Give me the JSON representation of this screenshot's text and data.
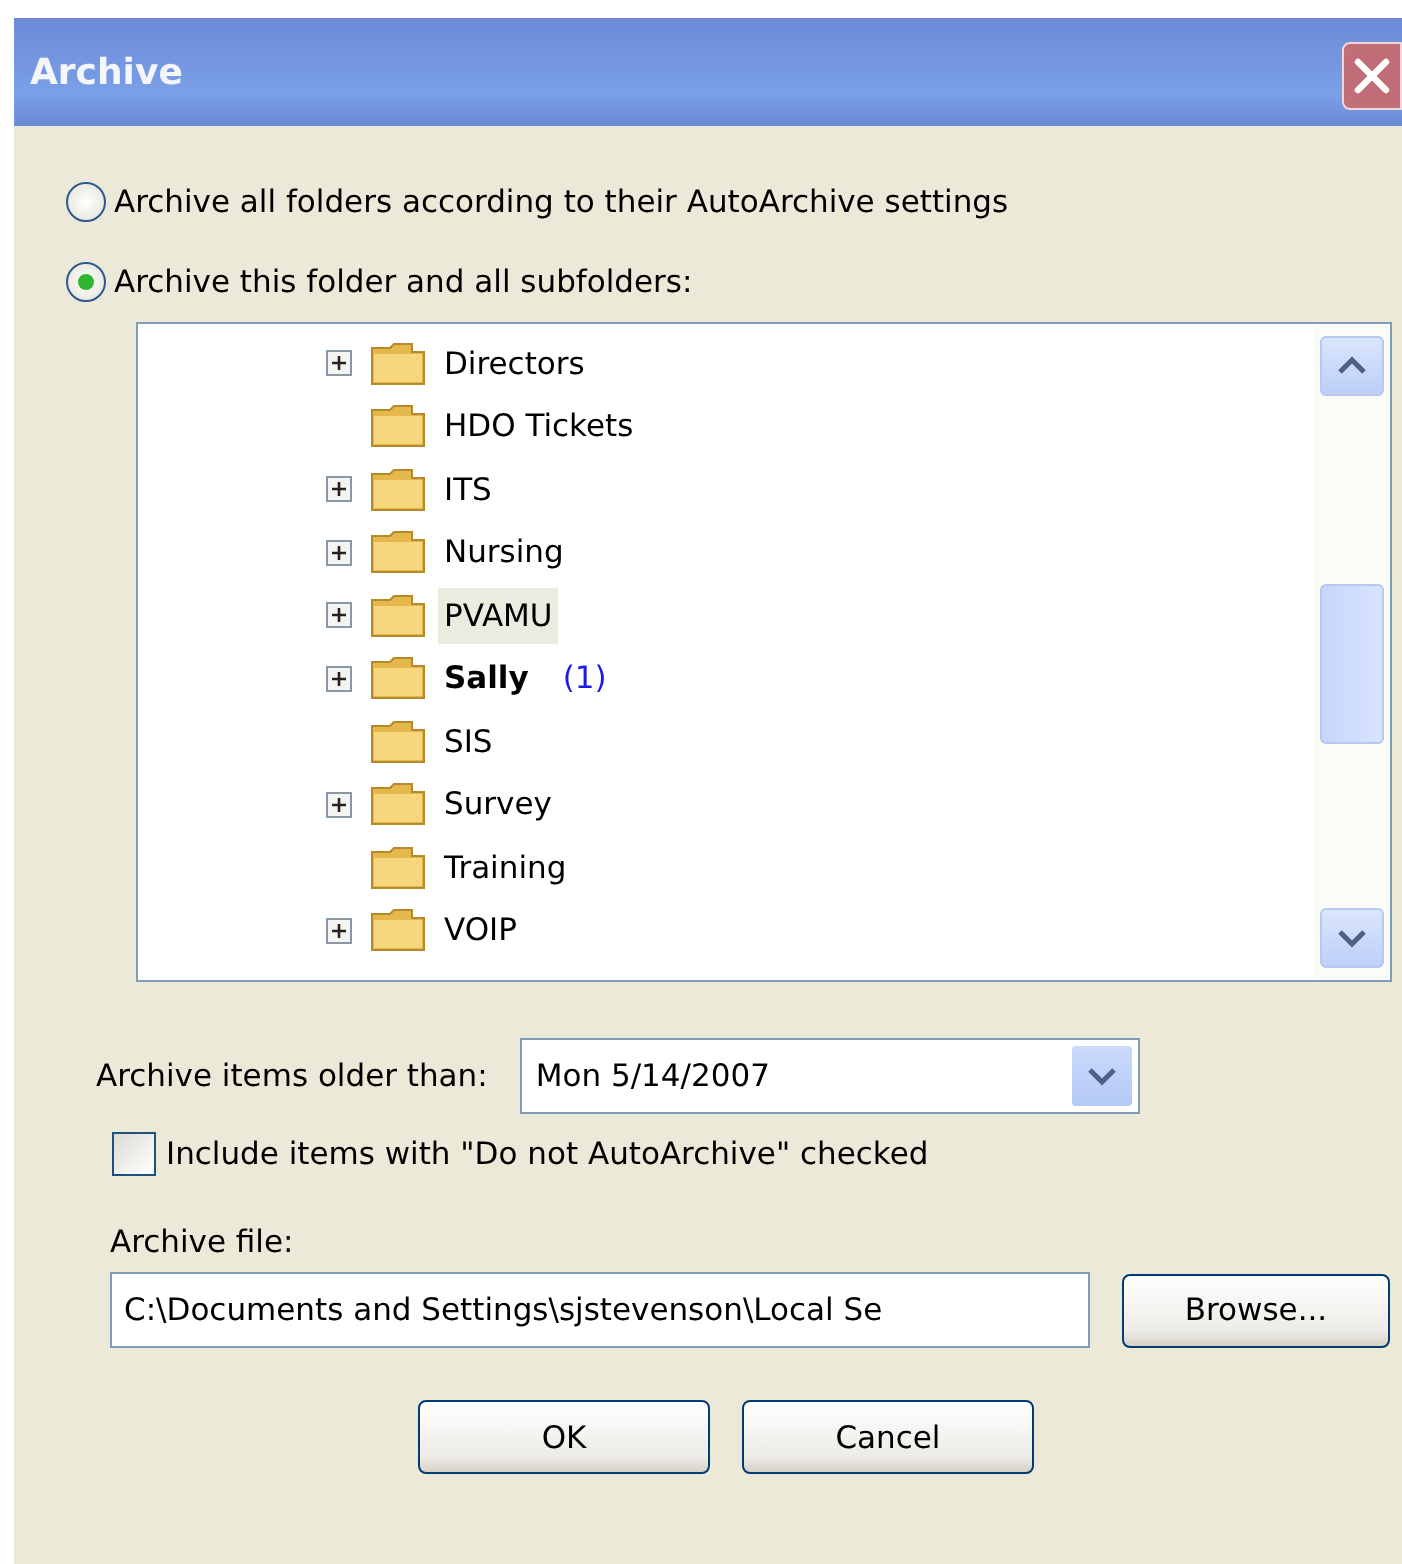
{
  "window": {
    "title": "Archive"
  },
  "options": [
    {
      "label": "Archive all folders according to their AutoArchive settings",
      "selected": false
    },
    {
      "label": "Archive this folder and all subfolders:",
      "selected": true
    }
  ],
  "folders": [
    {
      "name": "Directors",
      "expandable": true,
      "selected": false
    },
    {
      "name": "HDO Tickets",
      "expandable": false,
      "selected": false
    },
    {
      "name": "ITS",
      "expandable": true,
      "selected": false
    },
    {
      "name": "Nursing",
      "expandable": true,
      "selected": false
    },
    {
      "name": "PVAMU",
      "expandable": true,
      "selected": true
    },
    {
      "name": "Sally",
      "expandable": true,
      "selected": false,
      "unread": "(1)"
    },
    {
      "name": "SIS",
      "expandable": false,
      "selected": false
    },
    {
      "name": "Survey",
      "expandable": true,
      "selected": false
    },
    {
      "name": "Training",
      "expandable": false,
      "selected": false
    },
    {
      "name": "VOIP",
      "expandable": true,
      "selected": false
    }
  ],
  "older_than": {
    "label": "Archive items older than:",
    "value": "Mon 5/14/2007"
  },
  "include_checkbox": {
    "label": "Include items with \"Do not AutoArchive\" checked",
    "checked": false
  },
  "archive_file": {
    "label": "Archive file:",
    "value": "C:\\Documents and Settings\\sjstevenson\\Local Se"
  },
  "buttons": {
    "browse": "Browse...",
    "ok": "OK",
    "cancel": "Cancel"
  }
}
